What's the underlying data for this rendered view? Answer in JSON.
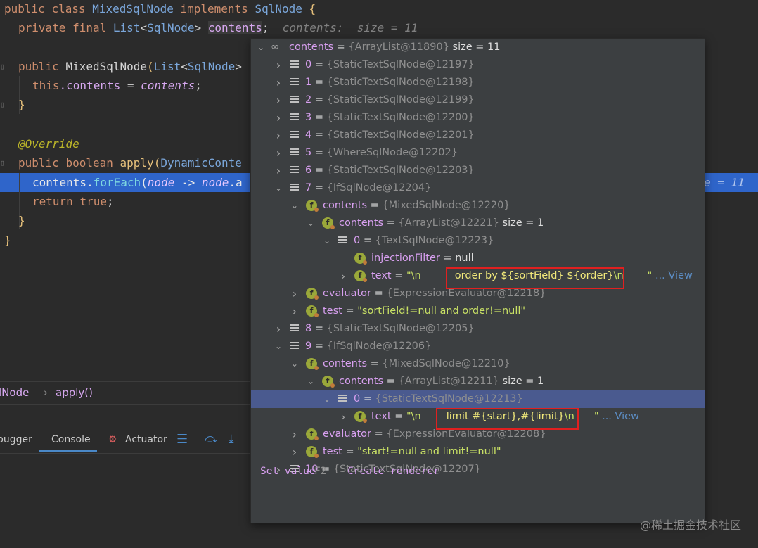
{
  "editor": {
    "lines": [
      {
        "kw1": "public",
        "kw2": "class",
        "name": "MixedSqlNode",
        "kw3": "implements",
        "iface": "SqlNode",
        "brace": "{"
      },
      {
        "kw1": "private",
        "kw2": "final",
        "type": "List",
        "gen": "SqlNode",
        "field": "contents",
        "semi": ";",
        "hint": "contents:  size = 11"
      },
      {
        "kw1": "public",
        "name": "MixedSqlNode",
        "paren": "(",
        "type": "List",
        "gen": "SqlNode",
        "rest": ">"
      },
      {
        "kw1": "this",
        "field": ".contents",
        "eq": " = ",
        "param": "contents",
        "semi": ";"
      },
      {
        "brace": "}"
      },
      {
        "ann": "@Override"
      },
      {
        "kw1": "public",
        "kw2": "boolean",
        "fn": "apply",
        "paren": "(",
        "type": "DynamicConte"
      },
      {
        "field": "contents",
        "dot": ".",
        "fn": "forEach",
        "paren": "(",
        "param": "node",
        "arrow": " -> ",
        "param2": "node",
        "tail": ".a"
      },
      {
        "kw1": "return",
        "kw2": "true",
        "semi": ";"
      },
      {
        "brace": "}"
      },
      {
        "brace": "}"
      }
    ],
    "right_hint": "e  = 11"
  },
  "breadcrumb": {
    "item1": "lNode",
    "sep": "›",
    "item2": "apply()"
  },
  "tool_tabs": {
    "debugger": "bugger",
    "console": "Console",
    "actuator": "Actuator"
  },
  "popup": {
    "root": {
      "name": "contents",
      "ref": "{ArrayList@11890}",
      "size": "size = 11"
    },
    "rows": [
      {
        "name": "0",
        "ref": "{StaticTextSqlNode@12197}"
      },
      {
        "name": "1",
        "ref": "{StaticTextSqlNode@12198}"
      },
      {
        "name": "2",
        "ref": "{StaticTextSqlNode@12199}"
      },
      {
        "name": "3",
        "ref": "{StaticTextSqlNode@12200}"
      },
      {
        "name": "4",
        "ref": "{StaticTextSqlNode@12201}"
      },
      {
        "name": "5",
        "ref": "{WhereSqlNode@12202}"
      },
      {
        "name": "6",
        "ref": "{StaticTextSqlNode@12203}"
      },
      {
        "name": "7",
        "ref": "{IfSqlNode@12204}"
      },
      {
        "name": "contents",
        "ref": "{MixedSqlNode@12220}"
      },
      {
        "name": "contents",
        "ref": "{ArrayList@12221}",
        "size": "size = 1"
      },
      {
        "name": "0",
        "ref": "{TextSqlNode@12223}"
      },
      {
        "name": "injectionFilter",
        "val": "null"
      },
      {
        "name": "text",
        "q1": "\"",
        "esc": "\\n",
        "mid": "order by ${sortField} ${order}",
        "esc2": "\\n",
        "q2": "\"",
        "view": "... View"
      },
      {
        "name": "evaluator",
        "ref": "{ExpressionEvaluator@12218}"
      },
      {
        "name": "test",
        "str": "\"sortField!=null and order!=null\""
      },
      {
        "name": "8",
        "ref": "{StaticTextSqlNode@12205}"
      },
      {
        "name": "9",
        "ref": "{IfSqlNode@12206}"
      },
      {
        "name": "contents",
        "ref": "{MixedSqlNode@12210}"
      },
      {
        "name": "contents",
        "ref": "{ArrayList@12211}",
        "size": "size = 1"
      },
      {
        "name": "0",
        "ref": "{StaticTextSqlNode@12213}"
      },
      {
        "name": "text",
        "q1": "\"",
        "esc": "\\n",
        "mid": "limit #{start},#{limit}",
        "esc2": "\\n",
        "q2": "\"",
        "view": "... View"
      },
      {
        "name": "evaluator",
        "ref": "{ExpressionEvaluator@12208}"
      },
      {
        "name": "test",
        "str": "\"start!=null and limit!=null\""
      },
      {
        "name": "10",
        "ref": "{StaticTextSqlNode@12207}"
      }
    ],
    "footer": {
      "set_value": "Set value",
      "set_key": "F2",
      "create_renderer": "Create renderer"
    }
  },
  "watermark": "@稀土掘金技术社区"
}
